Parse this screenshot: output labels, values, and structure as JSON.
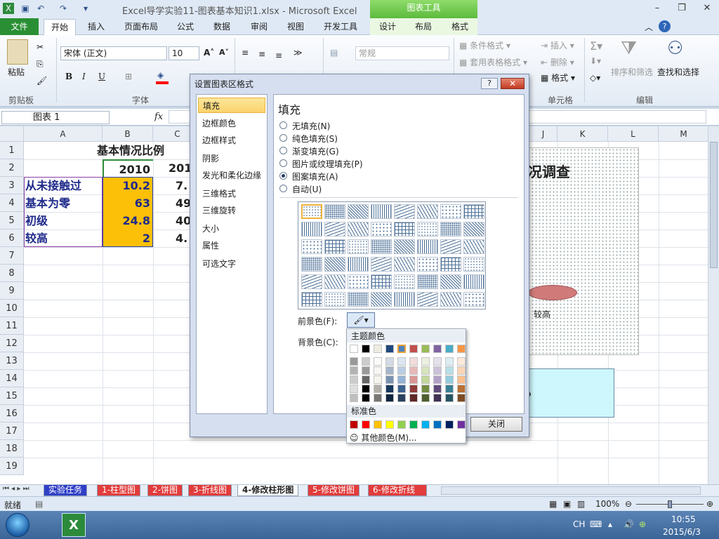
{
  "window": {
    "title": "Excel导学实验11-图表基本知识1.xlsx - Microsoft Excel",
    "chart_tools": "图表工具"
  },
  "ribbon_tabs": [
    "文件",
    "开始",
    "插入",
    "页面布局",
    "公式",
    "数据",
    "审阅",
    "视图",
    "开发工具",
    "设计",
    "布局",
    "格式"
  ],
  "ribbon": {
    "paste": "粘贴",
    "clipboard": "剪贴板",
    "font_group": "字体",
    "font_name": "宋体 (正文)",
    "font_size": "10",
    "bold": "B",
    "italic": "I",
    "underline": "U",
    "number_format": "常规",
    "cond_format": "条件格式",
    "table_format": "套用表格格式",
    "insert": "插入",
    "delete": "删除",
    "format": "格式",
    "cells_group": "单元格",
    "sort_filter": "排序和筛选",
    "find_select": "查找和选择",
    "edit_group": "编辑"
  },
  "formula_bar": {
    "name_box": "图表 1",
    "fx": "fx"
  },
  "columns": [
    "A",
    "B",
    "C",
    "J",
    "K",
    "L",
    "M"
  ],
  "rows": [
    "1",
    "2",
    "3",
    "4",
    "5",
    "6",
    "7",
    "8",
    "9",
    "10",
    "11",
    "12",
    "13",
    "14",
    "15",
    "16",
    "17",
    "18",
    "19"
  ],
  "sheet": {
    "title": "基本情况比例",
    "year_b": "2010",
    "year_c": "201",
    "labels": [
      "从未接触过",
      "基本为零",
      "初级",
      "较高"
    ],
    "col_b": [
      "10.2",
      "63",
      "24.8",
      "2"
    ],
    "col_c": [
      "7.",
      "49.",
      "40.",
      "4."
    ]
  },
  "chart_behind": {
    "title_fragment": "况调查",
    "label": "较高"
  },
  "textbox_fragment": "。",
  "dialog": {
    "title": "设置图表区格式",
    "help": "?",
    "close_x": "✕",
    "nav": [
      "填充",
      "边框颜色",
      "边框样式",
      "阴影",
      "发光和柔化边缘",
      "三维格式",
      "三维旋转",
      "大小",
      "属性",
      "可选文字"
    ],
    "heading": "填充",
    "options": [
      "无填充(N)",
      "纯色填充(S)",
      "渐变填充(G)",
      "图片或纹理填充(P)",
      "图案填充(A)",
      "自动(U)"
    ],
    "selected_option": 4,
    "foreground_label": "前景色(F):",
    "background_label": "背景色(C):",
    "close_button": "关闭"
  },
  "palette": {
    "theme_header": "主题颜色",
    "standard_header": "标准色",
    "more": "其他颜色(M)...",
    "theme_top": [
      "#ffffff",
      "#000000",
      "#eeece1",
      "#1f497d",
      "#4f81bd",
      "#c0504d",
      "#9bbb59",
      "#8064a2",
      "#4bacc6",
      "#f79646"
    ],
    "standard": [
      "#c00000",
      "#ff0000",
      "#ffc000",
      "#ffff00",
      "#92d050",
      "#00b050",
      "#00b0f0",
      "#0070c0",
      "#002060",
      "#7030a0"
    ]
  },
  "sheet_tabs": [
    "实验任务",
    "1-柱型图",
    "2-饼图",
    "3-折线图",
    "4-修改柱形图",
    "5-修改饼图",
    "6-修改折线"
  ],
  "status": {
    "ready": "就绪",
    "zoom": "100%"
  },
  "taskbar": {
    "lang": "CH",
    "time": "10:55",
    "date": "2015/6/3"
  }
}
